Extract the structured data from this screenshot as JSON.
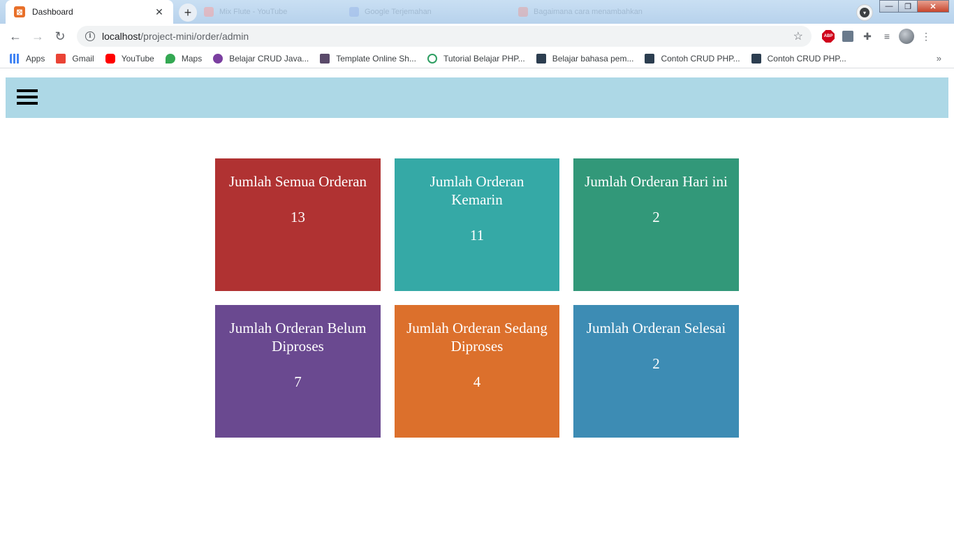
{
  "browser": {
    "active_tab": {
      "title": "Dashboard",
      "favicon": "xampp-icon"
    },
    "background_tabs": [
      "Mix Flute - YouTube",
      "Google Terjemahan",
      "Bagaimana cara menambahkan"
    ],
    "url_host": "localhost",
    "url_path": "/project-mini/order/admin",
    "bookmarks": [
      {
        "label": "Apps",
        "icon": "apps-grid-icon",
        "color": "#4285f4"
      },
      {
        "label": "Gmail",
        "icon": "gmail-icon",
        "color": "#ea4335"
      },
      {
        "label": "YouTube",
        "icon": "youtube-icon",
        "color": "#ff0000"
      },
      {
        "label": "Maps",
        "icon": "maps-pin-icon",
        "color": "#34a853"
      },
      {
        "label": "Belajar CRUD Java...",
        "icon": "site-icon",
        "color": "#7b3fa0"
      },
      {
        "label": "Template Online Sh...",
        "icon": "site-icon",
        "color": "#5a4a6a"
      },
      {
        "label": "Tutorial Belajar PHP...",
        "icon": "site-icon",
        "color": "#2e9e62"
      },
      {
        "label": "Belajar bahasa pem...",
        "icon": "codepolitan-icon",
        "color": "#2c3e50"
      },
      {
        "label": "Contoh CRUD PHP...",
        "icon": "codepolitan-icon",
        "color": "#2c3e50"
      },
      {
        "label": "Contoh CRUD PHP...",
        "icon": "codepolitan-icon",
        "color": "#2c3e50"
      }
    ]
  },
  "page": {
    "navbar_color": "#add8e6",
    "cards": [
      {
        "title": "Jumlah Semua Orderan",
        "value": "13",
        "color": "#b03232"
      },
      {
        "title": "Jumlah Orderan Kemarin",
        "value": "11",
        "color": "#35a9a6"
      },
      {
        "title": "Jumlah Orderan Hari ini",
        "value": "2",
        "color": "#329879"
      },
      {
        "title": "Jumlah Orderan Belum Diproses",
        "value": "7",
        "color": "#6a4990"
      },
      {
        "title": "Jumlah Orderan Sedang Diproses",
        "value": "4",
        "color": "#dc702c"
      },
      {
        "title": "Jumlah Orderan Selesai",
        "value": "2",
        "color": "#3d8cb4"
      }
    ]
  }
}
